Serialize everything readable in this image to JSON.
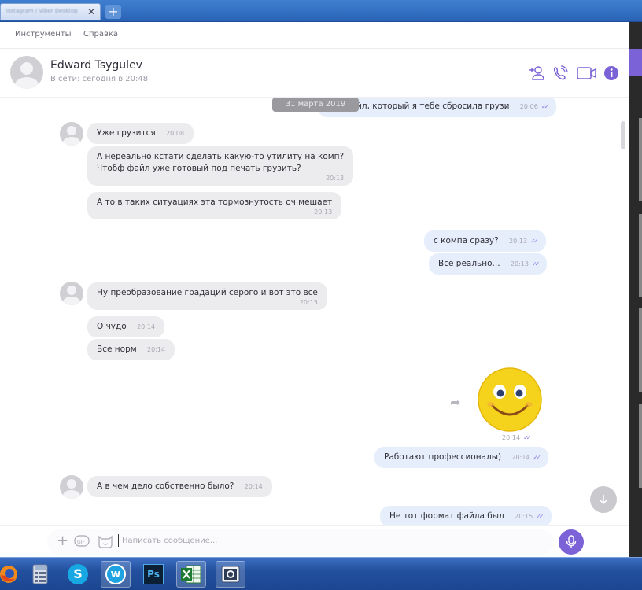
{
  "window": {
    "tab_title": "Instagram / Viber Desktop",
    "new_tab_symbol": "+"
  },
  "menu": {
    "items": [
      "Инструменты",
      "Справка"
    ]
  },
  "header": {
    "contact_name": "Edward Tsygulev",
    "status": "В сети: сегодня в 20:48",
    "icons": [
      "add-participant-icon",
      "phone-icon",
      "video-icon",
      "info-icon"
    ]
  },
  "chat": {
    "date_pill": "31 марта 2019",
    "messages": [
      {
        "dir": "out",
        "text": "это файл, который я тебе сбросила грузи",
        "time": "20:06"
      },
      {
        "dir": "in",
        "text": "Уже грузится",
        "time": "20:08"
      },
      {
        "dir": "in",
        "lines": [
          "А нереально кстати сделать какую-то утилиту на комп?",
          "Чтобф файл уже готовый под печать грузить?"
        ],
        "time": "20:13"
      },
      {
        "dir": "in",
        "text": "А то в таких ситуациях эта тормознутость оч мешает",
        "time": "20:13"
      },
      {
        "dir": "out",
        "text": "с компа сразу?",
        "time": "20:13"
      },
      {
        "dir": "out",
        "text": "Все реально...",
        "time": "20:13"
      },
      {
        "dir": "in",
        "text": "Ну преобразование градаций серого и вот это все",
        "time": "20:13"
      },
      {
        "dir": "in",
        "text": "О чудо",
        "time": "20:14"
      },
      {
        "dir": "in",
        "text": "Все норм",
        "time": "20:14"
      },
      {
        "dir": "out",
        "sticker": "smiley-sticker",
        "time": "20:14"
      },
      {
        "dir": "out",
        "text": "Работают профессионалы)",
        "time": "20:14"
      },
      {
        "dir": "in",
        "text": "А в чем дело собственно было?",
        "time": "20:14"
      },
      {
        "dir": "out",
        "text": "Не тот формат файла был",
        "time": "20:15"
      }
    ]
  },
  "composer": {
    "placeholder": "Написать сообщение..."
  },
  "taskbar": {
    "apps": [
      "firefox-icon",
      "calculator-icon",
      "skype-icon",
      "w-app-icon",
      "photoshop-icon",
      "excel-icon",
      "camera-app-icon"
    ],
    "ps_label": "Ps",
    "skype_label": "S",
    "w_label": "w"
  },
  "colors": {
    "accent": "#7b62d6",
    "outgoing_bubble": "#e6eefc",
    "incoming_bubble": "#ececef",
    "taskbar": "#23509e"
  }
}
